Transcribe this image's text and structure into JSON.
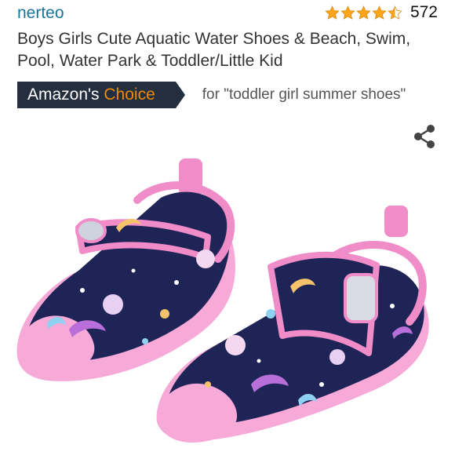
{
  "brand": "nerteo",
  "rating": {
    "stars": 4.5,
    "count": "572",
    "color": "#ffa41c"
  },
  "title": "Boys Girls Cute Aquatic Water Shoes & Beach, Swim, Pool, Water Park & Toddler/Little Kid",
  "badge": {
    "prefix": "Amazon's",
    "accent": "Choice",
    "query": "for \"toddler girl summer shoes\""
  },
  "share_icon": "share-icon",
  "product_image": {
    "icon": "product-photo",
    "shoe_color": "#1f2457",
    "trim_color": "#f08cc8",
    "sole_color": "#f7a9d8"
  }
}
